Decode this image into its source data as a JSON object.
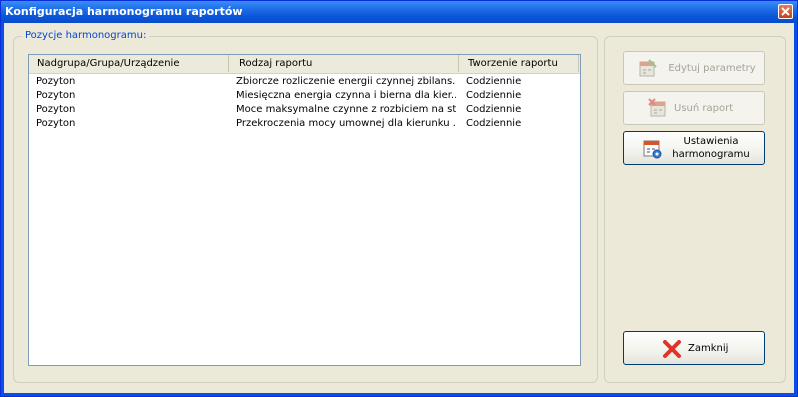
{
  "window": {
    "title": "Konfiguracja harmonogramu raportów"
  },
  "group": {
    "label": "Pozycje harmonogramu:"
  },
  "table": {
    "columns": [
      "Nadgrupa/Grupa/Urządzenie",
      "Rodzaj raportu",
      "Tworzenie raportu"
    ],
    "rows": [
      [
        "Pozyton",
        "Zbiorcze rozliczenie energii czynnej zbilans...",
        "Codziennie"
      ],
      [
        "Pozyton",
        "Miesięczna energia czynna i bierna dla kier...",
        "Codziennie"
      ],
      [
        "Pozyton",
        "Moce maksymalne czynne z rozbiciem na st...",
        "Codziennie"
      ],
      [
        "Pozyton",
        "Przekroczenia mocy umownej dla kierunku ...",
        "Codziennie"
      ]
    ]
  },
  "buttons": {
    "edit": {
      "label": "Edytuj parametry",
      "enabled": false,
      "icon": "calendar-edit-icon"
    },
    "delete": {
      "label": "Usuń raport",
      "enabled": false,
      "icon": "calendar-delete-icon"
    },
    "settings": {
      "label_line1": "Ustawienia",
      "label_line2": "harmonogramu",
      "enabled": true,
      "icon": "calendar-settings-icon"
    },
    "close": {
      "label": "Zamknij",
      "enabled": true,
      "icon": "red-x-icon"
    }
  },
  "colors": {
    "titlebar": "#0b56d8",
    "face": "#ece9d8",
    "group_label": "#0046d5"
  }
}
